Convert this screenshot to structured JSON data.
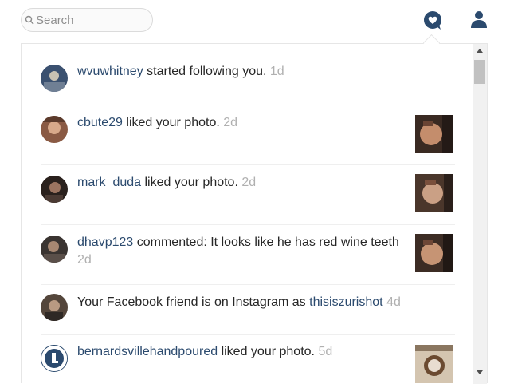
{
  "search": {
    "placeholder": "Search",
    "value": ""
  },
  "nav": {
    "activity_icon": "heart-bubble-icon",
    "profile_icon": "user-icon"
  },
  "colors": {
    "accent": "#2b4a6e",
    "username": "#2b4a6e",
    "timestamp": "#b0b0b0",
    "text": "#262626"
  },
  "notifications": [
    {
      "username": "wvuwhitney",
      "text": " started following you.",
      "time": "1d"
    },
    {
      "username": "cbute29",
      "text": " liked your photo.",
      "time": "2d"
    },
    {
      "username": "mark_duda",
      "text": " liked your photo.",
      "time": "2d"
    },
    {
      "username": "dhavp123",
      "text": " commented: It looks like he has red wine teeth",
      "time": "2d"
    },
    {
      "prefix": "Your Facebook friend is on Instagram as ",
      "username": "thisiszurishot",
      "time": "4d"
    },
    {
      "username": "bernardsvillehandpoured",
      "text": " liked your photo.",
      "time": "5d"
    }
  ]
}
